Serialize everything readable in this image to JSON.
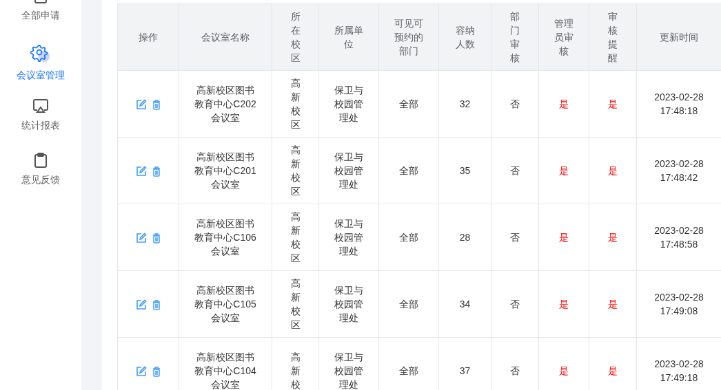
{
  "sidebar": {
    "items": [
      {
        "label": "全部申请",
        "selected": false
      },
      {
        "label": "会议室管理",
        "selected": true
      },
      {
        "label": "统计报表",
        "selected": false
      },
      {
        "label": "意见反馈",
        "selected": false
      }
    ]
  },
  "table": {
    "columns": [
      {
        "label": "操作",
        "kind": "actions"
      },
      {
        "label": "会议室名称",
        "kind": "text"
      },
      {
        "label": "所在校区",
        "kind": "text"
      },
      {
        "label": "所属单位",
        "kind": "text"
      },
      {
        "label": "可见可预约的部门",
        "kind": "text"
      },
      {
        "label": "容纳人数",
        "kind": "text"
      },
      {
        "label": "部门审核",
        "kind": "text"
      },
      {
        "label": "管理员审核",
        "kind": "flag"
      },
      {
        "label": "审核提醒",
        "kind": "flag"
      },
      {
        "label": "更新时间",
        "kind": "text"
      }
    ],
    "rows": [
      {
        "cells": [
          "",
          "高新校区图书教育中心C202会议室",
          "高新校区",
          "保卫与校园管理处",
          "全部",
          "32",
          "否",
          "是",
          "是",
          "2023-02-28 17:48:18"
        ]
      },
      {
        "cells": [
          "",
          "高新校区图书教育中心C201会议室",
          "高新校区",
          "保卫与校园管理处",
          "全部",
          "35",
          "否",
          "是",
          "是",
          "2023-02-28 17:48:42"
        ]
      },
      {
        "cells": [
          "",
          "高新校区图书教育中心C106会议室",
          "高新校区",
          "保卫与校园管理处",
          "全部",
          "28",
          "否",
          "是",
          "是",
          "2023-02-28 17:48:58"
        ]
      },
      {
        "cells": [
          "",
          "高新校区图书教育中心C105会议室",
          "高新校区",
          "保卫与校园管理处",
          "全部",
          "34",
          "否",
          "是",
          "是",
          "2023-02-28 17:49:08"
        ]
      },
      {
        "cells": [
          "",
          "高新校区图书教育中心C104会议室",
          "高新校",
          "保卫与校园管理处",
          "全部",
          "37",
          "否",
          "是",
          "是",
          "2023-02-28 17:49:18"
        ]
      }
    ]
  }
}
